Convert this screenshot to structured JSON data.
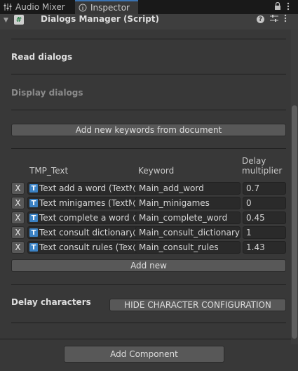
{
  "tabs": {
    "audio_mixer": "Audio Mixer",
    "inspector": "Inspector"
  },
  "component": {
    "title": "Dialogs Manager (Script)"
  },
  "sections": {
    "read_dialogs": "Read dialogs",
    "display_dialogs": "Display dialogs",
    "delay_characters": "Delay characters"
  },
  "buttons": {
    "add_keywords": "Add new keywords from document",
    "add_new": "Add new",
    "hide_character_config": "HIDE CHARACTER CONFIGURATION",
    "add_component": "Add Component",
    "remove": "X"
  },
  "table": {
    "col_tmp": "TMP_Text",
    "col_keyword": "Keyword",
    "col_delay_1": "Delay",
    "col_delay_2": "multiplier",
    "rows": [
      {
        "object": "Text add a word (TextMeshProUGUI)",
        "keyword": "Main_add_word",
        "delay": "0.7"
      },
      {
        "object": "Text minigames (TextMeshProUGUI)",
        "keyword": "Main_minigames",
        "delay": "0"
      },
      {
        "object": "Text complete a word (TextMeshProUGUI)",
        "keyword": "Main_complete_word",
        "delay": "0.45"
      },
      {
        "object": "Text consult dictionary (TextMeshProUGUI)",
        "keyword": "Main_consult_dictionary",
        "delay": "1"
      },
      {
        "object": "Text consult rules (TextMeshProUGUI)",
        "keyword": "Main_consult_rules",
        "delay": "1.43"
      }
    ]
  },
  "icons": {
    "mixer": "sliders-icon",
    "inspector": "info-icon",
    "lock": "lock-icon",
    "menu": "kebab-menu-icon",
    "script": "script-hash-icon",
    "help": "help-icon",
    "presets": "presets-icon",
    "tmp": "tmp-text-icon",
    "picker": "object-picker-icon"
  },
  "colors": {
    "background": "#383838",
    "tabbar": "#191919",
    "field": "#2a2a2a",
    "button": "#585858",
    "tmp_icon": "#3b82c4",
    "accent": "#3a72b0"
  }
}
